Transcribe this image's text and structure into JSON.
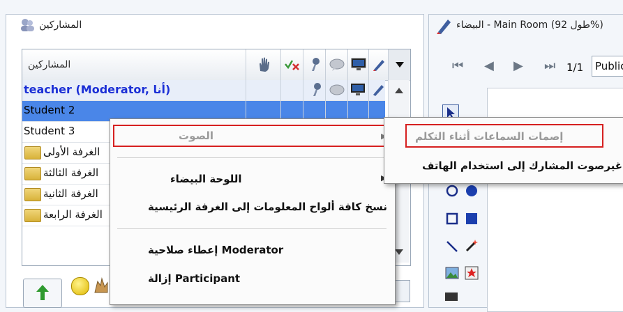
{
  "participants_panel": {
    "title": "المشاركين",
    "header_label": "المشاركين",
    "rows": [
      {
        "name": "teacher (Moderator, أنا)",
        "type": "moderator"
      },
      {
        "name": "Student 2",
        "type": "selected"
      },
      {
        "name": "Student 3",
        "type": "normal"
      },
      {
        "name": "الغرفة الأولى",
        "type": "room"
      },
      {
        "name": "الغرفة الثالثة",
        "type": "room"
      },
      {
        "name": "الغرفة الثانية",
        "type": "room"
      },
      {
        "name": "الغرفة الرابعة",
        "type": "room"
      }
    ]
  },
  "whiteboard_panel": {
    "title": "البيضاء - Main Room (طول 92%)",
    "page_indicator": "1/1",
    "dropdown_value": "Public"
  },
  "context_menu": {
    "items": [
      {
        "label": "الصوت",
        "disabled": true,
        "has_submenu": true,
        "highlighted": true
      },
      {
        "label": "اللوحة البيضاء",
        "disabled": false,
        "has_submenu": true
      },
      {
        "label": "نسخ كافة ألواح المعلومات إلى الغرفة الرئيسية",
        "disabled": false
      },
      {
        "label": "إعطاء صلاحية Moderator",
        "disabled": false
      },
      {
        "label": "إزالة Participant",
        "disabled": false
      }
    ]
  },
  "submenu": {
    "items": [
      {
        "label": "إصمات السماعات أثناء التكلم",
        "disabled": true,
        "highlighted": true
      },
      {
        "label": "غيرصوت المشارك إلى استخدام الهاتف.",
        "disabled": false
      }
    ]
  },
  "colors": {
    "selection": "#4a86e8",
    "moderator_text": "#1b2fd6",
    "highlight_border": "#d62020"
  }
}
